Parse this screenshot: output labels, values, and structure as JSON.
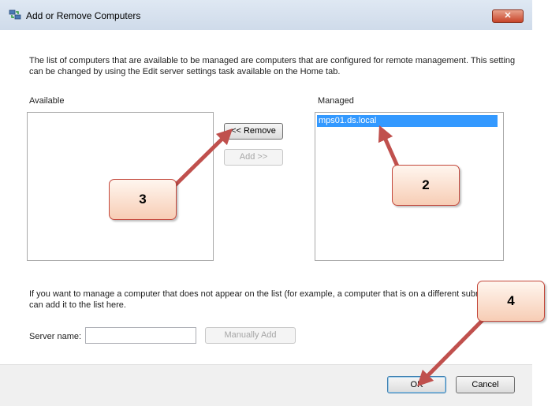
{
  "window": {
    "title": "Add or Remove Computers",
    "close_label": "✕"
  },
  "intro_text": "The list of computers that are available to be managed are computers that are configured for remote management. This setting can be changed by using the Edit server settings task available on the Home tab.",
  "available": {
    "label": "Available",
    "items": []
  },
  "managed": {
    "label": "Managed",
    "items": [
      "mps01.ds.local"
    ]
  },
  "buttons": {
    "remove": "<< Remove",
    "add": "Add >>",
    "manually_add": "Manually Add",
    "ok": "OK",
    "cancel": "Cancel"
  },
  "manual_text": "If you want to manage a computer that does not appear on the list (for example, a computer that is on a different subnet), you can add it to the list here.",
  "server_name": {
    "label": "Server name:",
    "value": ""
  },
  "callouts": [
    "2",
    "3",
    "4"
  ],
  "colors": {
    "selection": "#3399ff",
    "arrow": "#c0504d",
    "callout_border": "#c3473b"
  }
}
